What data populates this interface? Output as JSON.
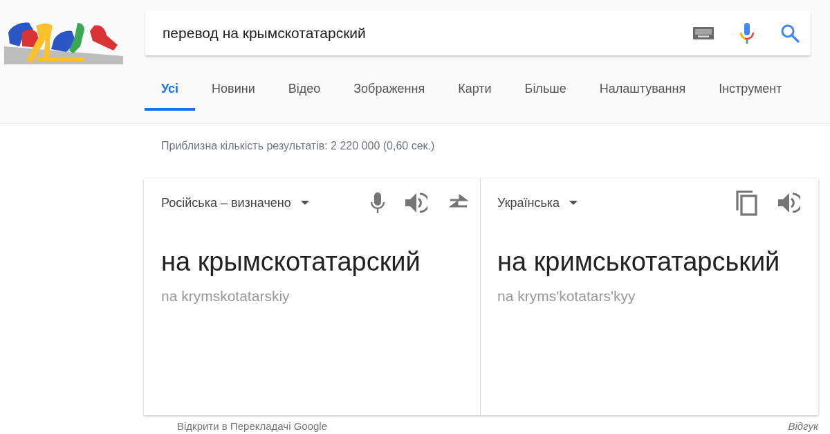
{
  "search": {
    "query": "перевод на крымскотатарский"
  },
  "tabs": [
    {
      "label": "Усі",
      "selected": true
    },
    {
      "label": "Новини",
      "selected": false
    },
    {
      "label": "Відео",
      "selected": false
    },
    {
      "label": "Зображення",
      "selected": false
    },
    {
      "label": "Карти",
      "selected": false
    },
    {
      "label": "Більше",
      "selected": false
    },
    {
      "label": "Налаштування",
      "selected": false
    },
    {
      "label": "Інструмент",
      "selected": false
    }
  ],
  "result_stats": "Приблизна кількість результатів: 2 220 000 (0,60 сек.)",
  "translator": {
    "source": {
      "language": "Російська – визначено",
      "text": "на крымскотатарский",
      "transliteration": "na krymskotatarskiy"
    },
    "target": {
      "language": "Українська",
      "text": "на кримськотатарський",
      "transliteration": "na kryms'kotatars'kyy"
    },
    "open_link": "Відкрити в Перекладачі Google",
    "feedback": "Відгук"
  }
}
